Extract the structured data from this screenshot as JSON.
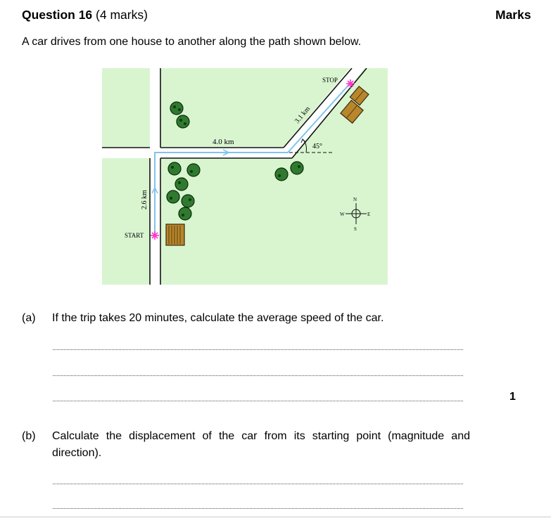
{
  "header": {
    "question": "Question 16",
    "marks_note": "(4 marks)",
    "marks_column": "Marks"
  },
  "intro": "A car drives from one house to another along the path shown below.",
  "diagram": {
    "stop_label": "STOP",
    "start_label": "START",
    "seg_north": "2.6 km",
    "seg_east": "4.0 km",
    "seg_diag": "3.1 km",
    "angle": "45°",
    "compass": {
      "n": "N",
      "s": "S",
      "e": "E",
      "w": "W"
    },
    "colors": {
      "grass": "#d8f5d0",
      "path": "#7fc4ee",
      "marker": "#ff33cc",
      "house": "#b8862b"
    }
  },
  "parts": [
    {
      "label": "(a)",
      "text": "If the trip takes 20 minutes, calculate the average speed of the car.",
      "marks": "1"
    },
    {
      "label": "(b)",
      "text": "Calculate the displacement of the car from its starting point (magnitude and direction).",
      "marks": ""
    }
  ]
}
